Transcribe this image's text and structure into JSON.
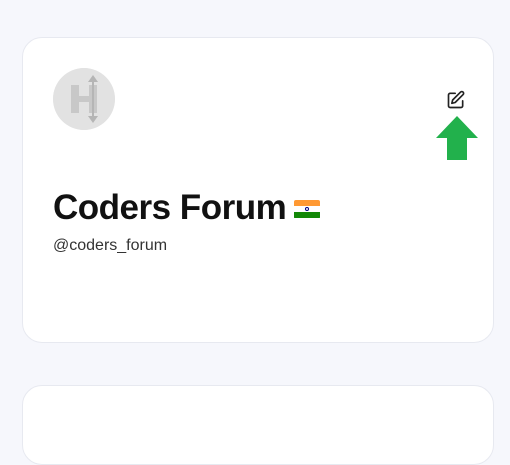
{
  "profile": {
    "name": "Coders Forum",
    "flag_icon": "india-flag-icon",
    "handle": "@coders_forum"
  },
  "icons": {
    "edit": "edit-icon",
    "arrow": "arrow-up-icon",
    "avatar": "hashnode-logo"
  },
  "colors": {
    "arrow": "#22b14c",
    "flag_saffron": "#ff9933",
    "flag_white": "#ffffff",
    "flag_green": "#138808",
    "flag_chakra": "#000080"
  }
}
